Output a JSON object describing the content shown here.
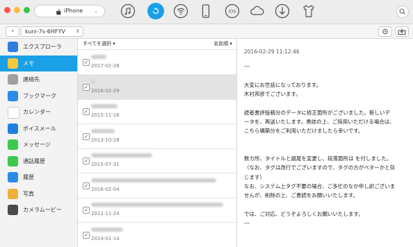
{
  "toolbar": {
    "device_name": "iPhone",
    "tools": [
      "music-icon",
      "recovery-icon",
      "wifi-icon",
      "phone-icon",
      "ios-icon",
      "cloud-icon",
      "download-icon",
      "tshirt-icon"
    ],
    "accent": "#1aa0e6"
  },
  "subbar": {
    "folder": "kuni-7s-6HFYV"
  },
  "sidebar": {
    "items": [
      {
        "label": "エクスプローラ",
        "icon": "explorer-icon",
        "color": "#2f7de1"
      },
      {
        "label": "メモ",
        "icon": "notes-icon",
        "color": "#f5c842"
      },
      {
        "label": "連絡先",
        "icon": "contacts-icon",
        "color": "#a0a0a0"
      },
      {
        "label": "ブックマーク",
        "icon": "bookmark-icon",
        "color": "#2b8be6"
      },
      {
        "label": "カレンダー",
        "icon": "calendar-icon",
        "color": "#ffffff"
      },
      {
        "label": "ボイスメール",
        "icon": "voicemail-icon",
        "color": "#1f7fe0"
      },
      {
        "label": "メッセージ",
        "icon": "messages-icon",
        "color": "#3cc84c"
      },
      {
        "label": "通話履歴",
        "icon": "call-history-icon",
        "color": "#3cc84c"
      },
      {
        "label": "履歴",
        "icon": "history-icon",
        "color": "#2b8be6"
      },
      {
        "label": "写真",
        "icon": "photos-icon",
        "color": "#f0b040"
      },
      {
        "label": "カメラムービー",
        "icon": "camera-movie-icon",
        "color": "#4a4a4a"
      }
    ],
    "active_index": 1
  },
  "list": {
    "select_all": "すべてを選択",
    "sort_label": "名前順",
    "rows": [
      {
        "date": "2017-02-26",
        "checked": true,
        "selected": false,
        "blur_width": 22
      },
      {
        "date": "2016-02-29",
        "checked": true,
        "selected": true,
        "blur_width": 6
      },
      {
        "date": "2015-11-16",
        "checked": true,
        "selected": false,
        "blur_width": 38
      },
      {
        "date": "2013-10-28",
        "checked": true,
        "selected": false,
        "blur_width": 34
      },
      {
        "date": "2015-07-31",
        "checked": true,
        "selected": false,
        "blur_width": 88
      },
      {
        "date": "2016-02-04",
        "checked": true,
        "selected": false,
        "blur_width": 180
      },
      {
        "date": "2012-11-24",
        "checked": true,
        "selected": false,
        "blur_width": 190
      },
      {
        "date": "2014-01-14",
        "checked": true,
        "selected": false,
        "blur_width": 46
      }
    ]
  },
  "detail": {
    "datetime": "2016-02-29 11:12:46",
    "lines": [
      "---",
      "",
      "大変にお世話になっております。",
      "木村邦彦でございます。",
      "",
      "読者書評投稿分のデータに修正箇所がございました。新しいデ",
      "ータを、再送いたします。貴誌の上、ご採用いただける場合は、",
      "こちら構築分をご利用いただけましたら幸いです。",
      "",
      "",
      "数カ所、タイトルと語尾を変更し、段落箇所は を付しました。",
      "（なお、タグは改行でございますので、タグの方がベターかと存",
      "じます）",
      "なお、システム上タグ不要の場合、ご多忙のなか申し訳ございま",
      "せんが、削除の上、ご書読をお願いいたします。",
      "",
      "では、ご対応、どうぞよろしくお願いいたします。",
      "---"
    ]
  }
}
